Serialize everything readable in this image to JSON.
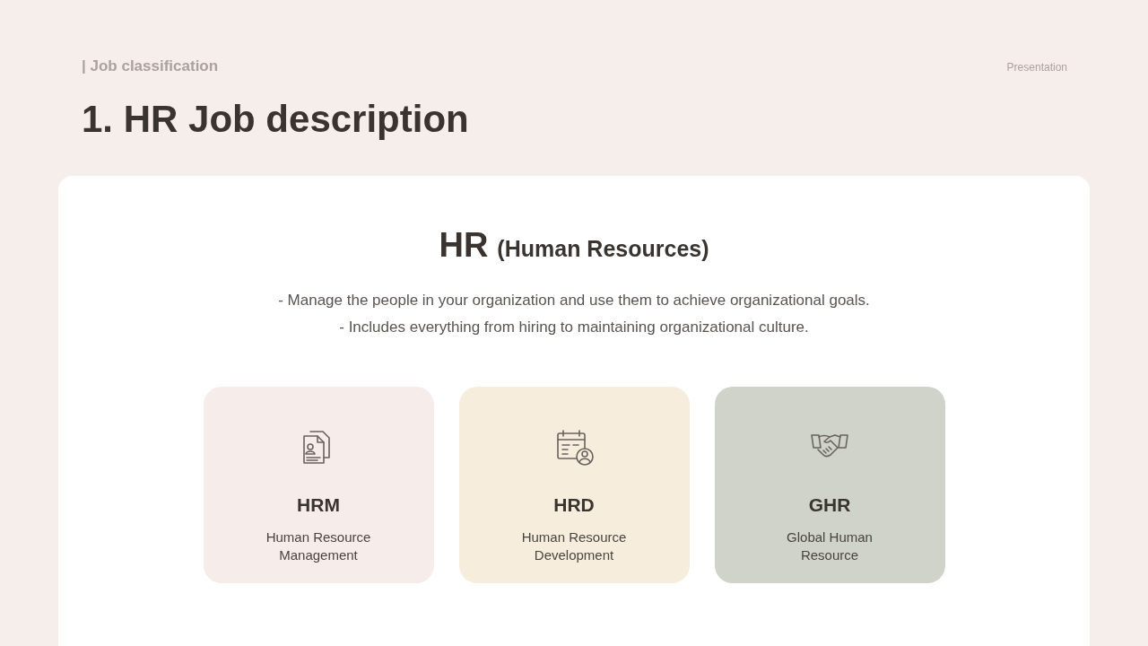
{
  "header": {
    "section_label": "| Job classification",
    "tag": "Presentation",
    "title": "1. HR Job description"
  },
  "panel": {
    "heading": "HR",
    "heading_note": "(Human Resources)",
    "bullets": [
      "- Manage the people in your organization and use them to achieve organizational goals.",
      "- Includes everything from hiring to maintaining organizational culture."
    ],
    "cards": [
      {
        "kind": "documents",
        "title": "HRM",
        "description": "Human Resource Management",
        "color": "#f6ecea"
      },
      {
        "kind": "calendar",
        "title": "HRD",
        "description": "Human Resource Development",
        "color": "#f6eddc"
      },
      {
        "kind": "handshake",
        "title": "GHR",
        "description": "Global Human Resource",
        "color": "#cfd3ca"
      }
    ]
  }
}
